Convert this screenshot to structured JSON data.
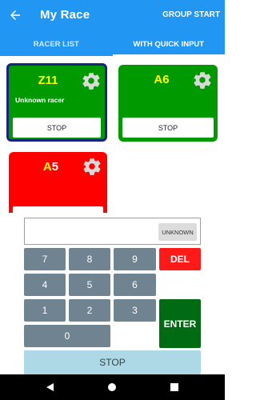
{
  "appbar": {
    "title": "My Race",
    "action_label": "GROUP START",
    "color": "#2196f3"
  },
  "tabs": [
    {
      "label": "RACER LIST",
      "active": false
    },
    {
      "label": "WITH QUICK INPUT",
      "active": true
    }
  ],
  "racers": [
    {
      "prefix": "Z",
      "number": "11",
      "subtitle": "Unknown racer",
      "stop_label": "STOP",
      "color": "#009900",
      "border": "#1a237e",
      "prefix_color": "#ffff00"
    },
    {
      "prefix": "A",
      "number": "6",
      "subtitle": "",
      "stop_label": "STOP",
      "color": "#009900",
      "border": "",
      "prefix_color": "#ffff00"
    },
    {
      "prefix": "A",
      "number": "5",
      "subtitle": "",
      "stop_label": "",
      "color": "#ff0000",
      "border": "",
      "prefix_color": "#ffff00"
    }
  ],
  "input": {
    "value": "",
    "unknown_label": "UNKNOWN"
  },
  "keypad": {
    "keys": [
      "7",
      "8",
      "9",
      "4",
      "5",
      "6",
      "1",
      "2",
      "3",
      "0"
    ],
    "del_label": "DEL",
    "enter_label": "ENTER",
    "stop_label": "STOP"
  },
  "icons": {
    "back": "arrow-left-icon",
    "gear": "gear-icon",
    "nav_back": "triangle-back-icon",
    "nav_home": "circle-home-icon",
    "nav_recent": "square-recent-icon"
  }
}
